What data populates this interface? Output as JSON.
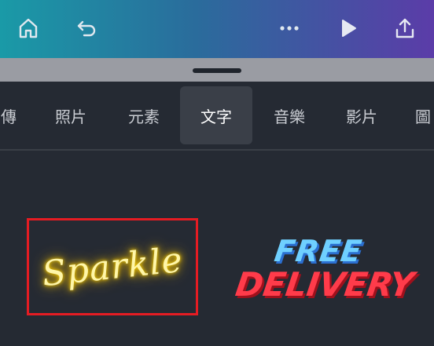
{
  "topbar": {
    "icons": [
      "home-icon",
      "undo-icon",
      "more-icon",
      "play-icon",
      "share-icon"
    ],
    "gradient": [
      "#1a9aa7",
      "#5b3ca8"
    ]
  },
  "tabs": [
    {
      "label": "傳",
      "active": false
    },
    {
      "label": "照片",
      "active": false
    },
    {
      "label": "元素",
      "active": false
    },
    {
      "label": "文字",
      "active": true
    },
    {
      "label": "音樂",
      "active": false
    },
    {
      "label": "影片",
      "active": false
    },
    {
      "label": "圖",
      "active": false
    }
  ],
  "content": {
    "items": [
      {
        "text": "Sparkle",
        "style": "neon-script",
        "highlighted": true
      },
      {
        "line1": "FREE",
        "line2": "DELIVERY",
        "style": "bold-italic"
      }
    ],
    "colors": {
      "highlight_border": "#e51c23",
      "neon": "#ffd400",
      "free": "#6fd0ff",
      "delivery": "#ff3b4a"
    }
  }
}
